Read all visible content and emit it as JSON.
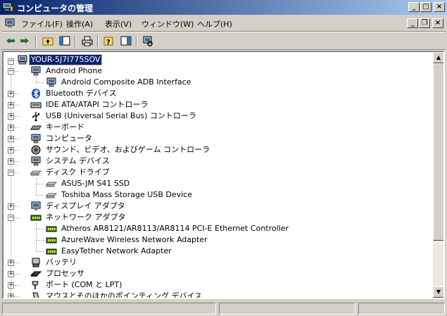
{
  "window": {
    "title": "コンピュータの管理"
  },
  "menu": [
    {
      "id": "file",
      "label": "ファイル(F)"
    },
    {
      "id": "action",
      "label": "操作(A)"
    },
    {
      "id": "view",
      "label": "表示(V)"
    },
    {
      "id": "window",
      "label": "ウィンドウ(W)"
    },
    {
      "id": "help",
      "label": "ヘルプ(H)"
    }
  ],
  "tree": {
    "root": "YOUR-5J7I775SOV",
    "items": [
      {
        "label": "Android Phone",
        "level": 1,
        "expanded": true,
        "icon": "device-icon"
      },
      {
        "label": "Android Composite ADB Interface",
        "level": 2,
        "icon": "device-icon"
      },
      {
        "label": "Bluetooth デバイス",
        "level": 1,
        "expanded": false,
        "icon": "bluetooth-icon"
      },
      {
        "label": "IDE ATA/ATAPI コントローラ",
        "level": 1,
        "expanded": false,
        "icon": "ide-controller-icon"
      },
      {
        "label": "USB (Universal Serial Bus) コントローラ",
        "level": 1,
        "expanded": false,
        "icon": "usb-icon"
      },
      {
        "label": "キーボード",
        "level": 1,
        "expanded": false,
        "icon": "keyboard-icon"
      },
      {
        "label": "コンピュータ",
        "level": 1,
        "expanded": false,
        "icon": "computer-icon"
      },
      {
        "label": "サウンド、ビデオ、およびゲーム コントローラ",
        "level": 1,
        "expanded": false,
        "icon": "sound-icon"
      },
      {
        "label": "システム デバイス",
        "level": 1,
        "expanded": false,
        "icon": "system-device-icon"
      },
      {
        "label": "ディスク ドライブ",
        "level": 1,
        "expanded": true,
        "icon": "disk-drive-icon"
      },
      {
        "label": "ASUS-JM S41 SSD",
        "level": 2,
        "icon": "disk-drive-icon"
      },
      {
        "label": "Toshiba Mass Storage USB Device",
        "level": 2,
        "icon": "disk-drive-icon"
      },
      {
        "label": "ディスプレイ アダプタ",
        "level": 1,
        "expanded": false,
        "icon": "display-adapter-icon"
      },
      {
        "label": "ネットワーク アダプタ",
        "level": 1,
        "expanded": true,
        "icon": "network-adapter-icon"
      },
      {
        "label": "Atheros AR8121/AR8113/AR8114 PCI-E Ethernet Controller",
        "level": 2,
        "icon": "network-adapter-icon"
      },
      {
        "label": "AzureWave Wireless Network Adapter",
        "level": 2,
        "icon": "network-adapter-icon"
      },
      {
        "label": "EasyTether Network Adapter",
        "level": 2,
        "icon": "network-adapter-icon"
      },
      {
        "label": "バッテリ",
        "level": 1,
        "expanded": false,
        "icon": "battery-icon"
      },
      {
        "label": "プロセッサ",
        "level": 1,
        "expanded": false,
        "icon": "processor-icon"
      },
      {
        "label": "ポート (COM と LPT)",
        "level": 1,
        "expanded": false,
        "icon": "port-icon"
      },
      {
        "label": "マウスとそのほかのポインティング デバイス",
        "level": 1,
        "expanded": false,
        "icon": "mouse-icon"
      }
    ]
  },
  "colors": {
    "titlebar_start": "#0a246a",
    "titlebar_end": "#a6caf0",
    "selection": "#0a246a",
    "chrome": "#d4d0c8"
  }
}
